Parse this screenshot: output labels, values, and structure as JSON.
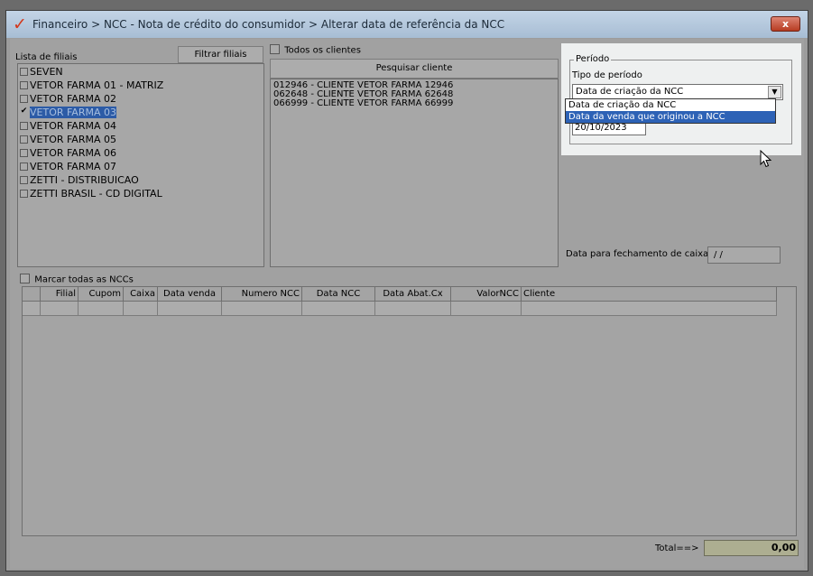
{
  "window": {
    "title": "Financeiro > NCC - Nota de crédito do consumidor > Alterar data de referência da NCC",
    "close_label": "x"
  },
  "branches": {
    "label": "Lista de filiais",
    "filter_button": "Filtrar filiais",
    "items": [
      {
        "label": "SEVEN",
        "checked": false
      },
      {
        "label": "VETOR FARMA 01 - MATRIZ",
        "checked": false
      },
      {
        "label": "VETOR FARMA 02",
        "checked": false
      },
      {
        "label": "VETOR FARMA 03",
        "checked": true
      },
      {
        "label": "VETOR FARMA 04",
        "checked": false
      },
      {
        "label": "VETOR FARMA 05",
        "checked": false
      },
      {
        "label": "VETOR FARMA 06",
        "checked": false
      },
      {
        "label": "VETOR FARMA 07",
        "checked": false
      },
      {
        "label": "ZETTI - DISTRIBUICAO",
        "checked": false
      },
      {
        "label": "ZETTI BRASIL - CD DIGITAL",
        "checked": false
      }
    ]
  },
  "clients": {
    "all_clients_label": "Todos os clientes",
    "search_button": "Pesquisar cliente",
    "items": [
      "012946 - CLIENTE VETOR FARMA 12946",
      "062648 - CLIENTE VETOR FARMA 62648",
      "066999 - CLIENTE VETOR FARMA 66999"
    ]
  },
  "period": {
    "group_label": "Período",
    "type_label": "Tipo de período",
    "selected": "Data de criação da NCC",
    "date_value": "20/10/2023",
    "options": [
      "Data de criação da NCC",
      "Data da venda que originou a NCC"
    ]
  },
  "cash_closing": {
    "label": "Data para fechamento de caixa",
    "value": "/ /"
  },
  "ncc_grid": {
    "mark_all_label": "Marcar todas as NCCs",
    "columns": [
      "",
      "Filial",
      "Cupom",
      "Caixa",
      "Data venda",
      "Numero NCC",
      "Data NCC",
      "Data Abat.Cx",
      "ValorNCC",
      "Cliente"
    ]
  },
  "total": {
    "label": "Total==>",
    "value": "0,00"
  }
}
